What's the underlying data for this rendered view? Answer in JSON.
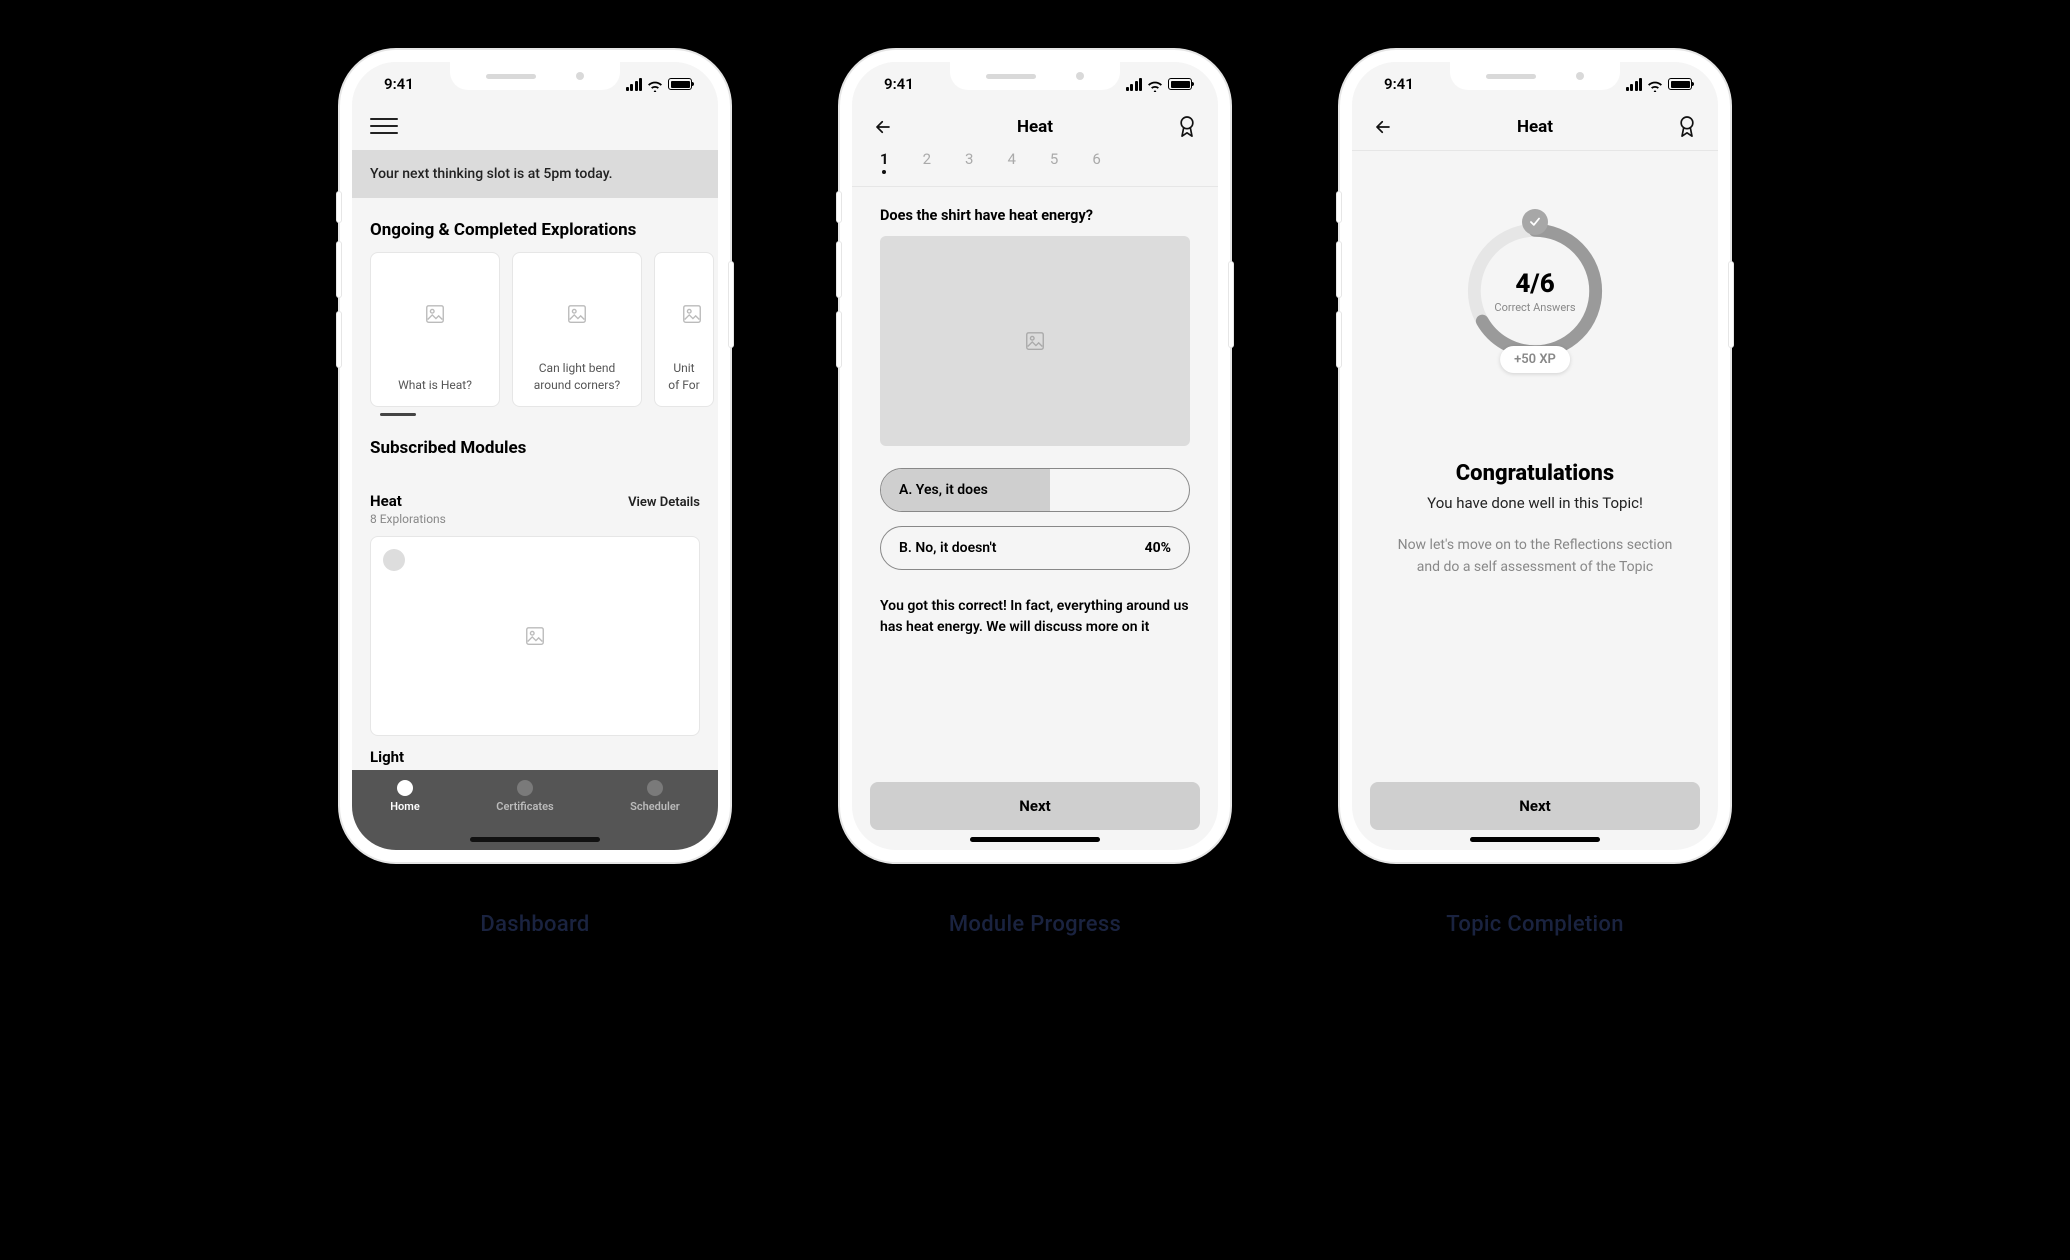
{
  "status_time": "9:41",
  "captions": {
    "s1": "Dashboard",
    "s2": "Module Progress",
    "s3": "Topic Completion"
  },
  "s1": {
    "banner": "Your next thinking slot is at 5pm today.",
    "explorations_title": "Ongoing & Completed Explorations",
    "exploration_cards": [
      "What is Heat?",
      "Can light bend around corners?",
      "Unit of For"
    ],
    "modules_title": "Subscribed Modules",
    "module": {
      "name": "Heat",
      "sub": "8 Explorations",
      "link": "View Details"
    },
    "next_module": "Light",
    "tabs": [
      "Home",
      "Certificates",
      "Scheduler"
    ]
  },
  "s2": {
    "title": "Heat",
    "steps": [
      "1",
      "2",
      "3",
      "4",
      "5",
      "6"
    ],
    "question": "Does the shirt have heat energy?",
    "choice_a": "A. Yes, it does",
    "choice_b": "B. No, it doesn't",
    "choice_b_pct": "40%",
    "feedback": "You got this correct! In fact, everything around us has heat  energy. We will discuss more on it",
    "next": "Next"
  },
  "s3": {
    "title": "Heat",
    "score": "4/6",
    "score_label": "Correct Answers",
    "xp": "+50 XP",
    "congrats": "Congratulations",
    "congrats_sub": "You have done well in this Topic!",
    "body": "Now let's move on to the Reflections section and do a self assessment of the Topic",
    "next": "Next"
  }
}
